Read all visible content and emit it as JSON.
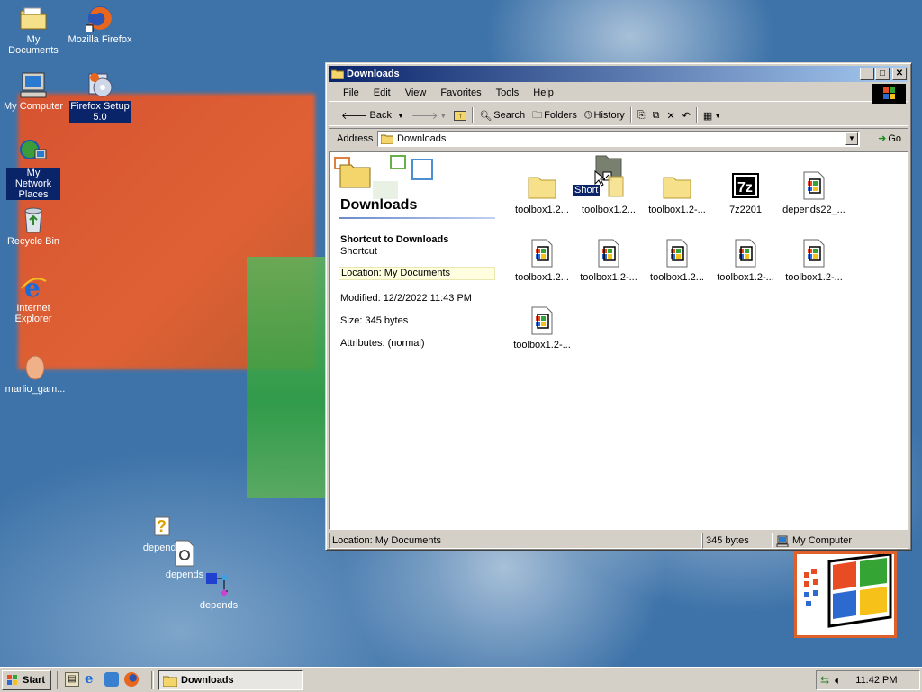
{
  "desktop": {
    "icons": [
      {
        "label": "My Documents"
      },
      {
        "label": "Mozilla Firefox"
      },
      {
        "label": "My Computer"
      },
      {
        "label": "Firefox Setup 5.0"
      },
      {
        "label": "My Network Places"
      },
      {
        "label": "Recycle Bin"
      },
      {
        "label": "Internet Explorer"
      },
      {
        "label": "marlio_gam..."
      },
      {
        "label": "depends"
      },
      {
        "label": "depends"
      },
      {
        "label": "depends"
      }
    ]
  },
  "window": {
    "title": "Downloads",
    "menu": [
      "File",
      "Edit",
      "View",
      "Favorites",
      "Tools",
      "Help"
    ],
    "toolbar": {
      "back": "Back",
      "search": "Search",
      "folders": "Folders",
      "history": "History"
    },
    "address": {
      "label": "Address",
      "value": "Downloads",
      "go": "Go"
    },
    "sidepanel": {
      "title": "Downloads",
      "item_name": "Shortcut to Downloads",
      "item_type": "Shortcut",
      "location": "Location: My Documents",
      "modified": "Modified: 12/2/2022 11:43 PM",
      "size": "Size: 345 bytes",
      "attributes": "Attributes: (normal)"
    },
    "files": [
      {
        "name": "toolbox1.2...",
        "kind": "folder"
      },
      {
        "name": "toolbox1.2...",
        "kind": "folder-shortcut",
        "drag_label": "Short"
      },
      {
        "name": "toolbox1.2-...",
        "kind": "folder"
      },
      {
        "name": "7z2201",
        "kind": "7z"
      },
      {
        "name": "depends22_...",
        "kind": "installer"
      },
      {
        "name": "toolbox1.2...",
        "kind": "installer"
      },
      {
        "name": "toolbox1.2-...",
        "kind": "installer"
      },
      {
        "name": "toolbox1.2...",
        "kind": "installer"
      },
      {
        "name": "toolbox1.2-...",
        "kind": "installer"
      },
      {
        "name": "toolbox1.2-...",
        "kind": "installer"
      },
      {
        "name": "toolbox1.2-...",
        "kind": "installer"
      }
    ],
    "status": {
      "location": "Location: My Documents",
      "size": "345 bytes",
      "zone": "My Computer"
    }
  },
  "taskbar": {
    "start": "Start",
    "task": "Downloads",
    "clock": "11:42 PM"
  }
}
